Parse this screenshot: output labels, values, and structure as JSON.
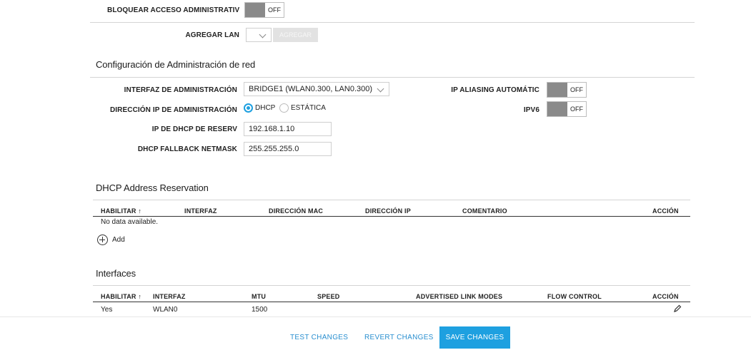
{
  "top": {
    "block_admin_label": "BLOQUEAR ACCESO ADMINISTRATIV",
    "block_admin_toggle": "OFF",
    "add_lan_label": "AGREGAR LAN",
    "add_lan_button": "AGREGAR"
  },
  "mgmt": {
    "title": "Configuración de Administración de red",
    "interface_label": "INTERFAZ DE ADMINISTRACIÓN",
    "interface_value": "BRIDGE1 (WLAN0.300, LAN0.300)",
    "ip_mode_label": "DIRECCIÓN IP DE ADMINISTRACIÓN",
    "ip_mode_options": [
      "DHCP",
      "ESTÁTICA"
    ],
    "ip_mode_selected": "DHCP",
    "dhcp_reserve_label": "IP DE DHCP DE RESERV",
    "dhcp_reserve_value": "192.168.1.10",
    "fallback_mask_label": "DHCP FALLBACK NETMASK",
    "fallback_mask_value": "255.255.255.0",
    "ip_aliasing_label": "IP ALIASING AUTOMÁTIC",
    "ip_aliasing_toggle": "OFF",
    "ipv6_label": "IPV6",
    "ipv6_toggle": "OFF"
  },
  "reservation": {
    "title": "DHCP Address Reservation",
    "columns": [
      "HABILITAR ↑",
      "INTERFAZ",
      "DIRECCIÓN MAC",
      "DIRECCIÓN IP",
      "COMENTARIO",
      "ACCIÓN"
    ],
    "empty_text": "No data available.",
    "add_label": "Add"
  },
  "interfaces": {
    "title": "Interfaces",
    "columns": [
      "HABILITAR ↑",
      "INTERFAZ",
      "MTU",
      "SPEED",
      "ADVERTISED LINK MODES",
      "FLOW CONTROL",
      "ACCIÓN"
    ],
    "rows": [
      {
        "enabled": "Yes",
        "interface": "WLAN0",
        "mtu": "1500",
        "speed": "",
        "link_modes": "",
        "flow_control": ""
      }
    ]
  },
  "footer": {
    "test": "TEST CHANGES",
    "revert": "REVERT CHANGES",
    "save": "SAVE CHANGES"
  },
  "colors": {
    "accent": "#1ea0e0",
    "toggle_off_knob": "#8a8a8a"
  }
}
